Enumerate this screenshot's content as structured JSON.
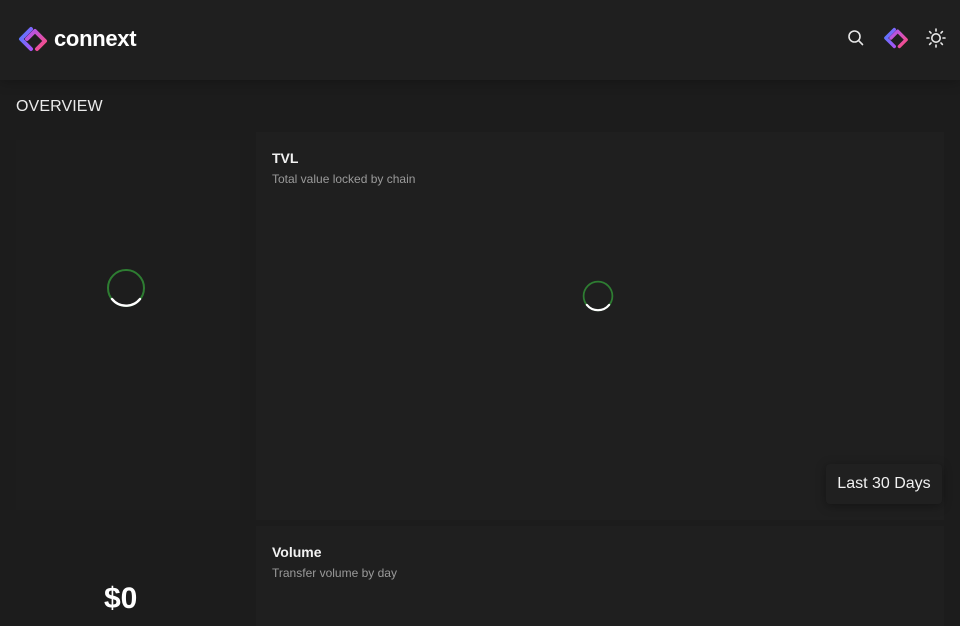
{
  "header": {
    "brand": "connext",
    "logo_icon": "connext-logo-icon",
    "actions": [
      {
        "name": "search-icon"
      },
      {
        "name": "connext-app-icon"
      },
      {
        "name": "sun-icon"
      }
    ]
  },
  "page": {
    "title": "OVERVIEW"
  },
  "tvl_card": {
    "title": "TVL",
    "subtitle": "Total value locked by chain",
    "status": "loading"
  },
  "range_selector": {
    "label": "Last 30 Days"
  },
  "volume_card": {
    "title": "Volume",
    "subtitle": "Transfer volume by day",
    "value": "$0"
  },
  "colors": {
    "background": "#1c1c1c",
    "card": "#1f1f1f",
    "spinner_accent": "#2e7d32",
    "logo_gradient_start": "#5a7cfa",
    "logo_gradient_end": "#e84a8a"
  }
}
